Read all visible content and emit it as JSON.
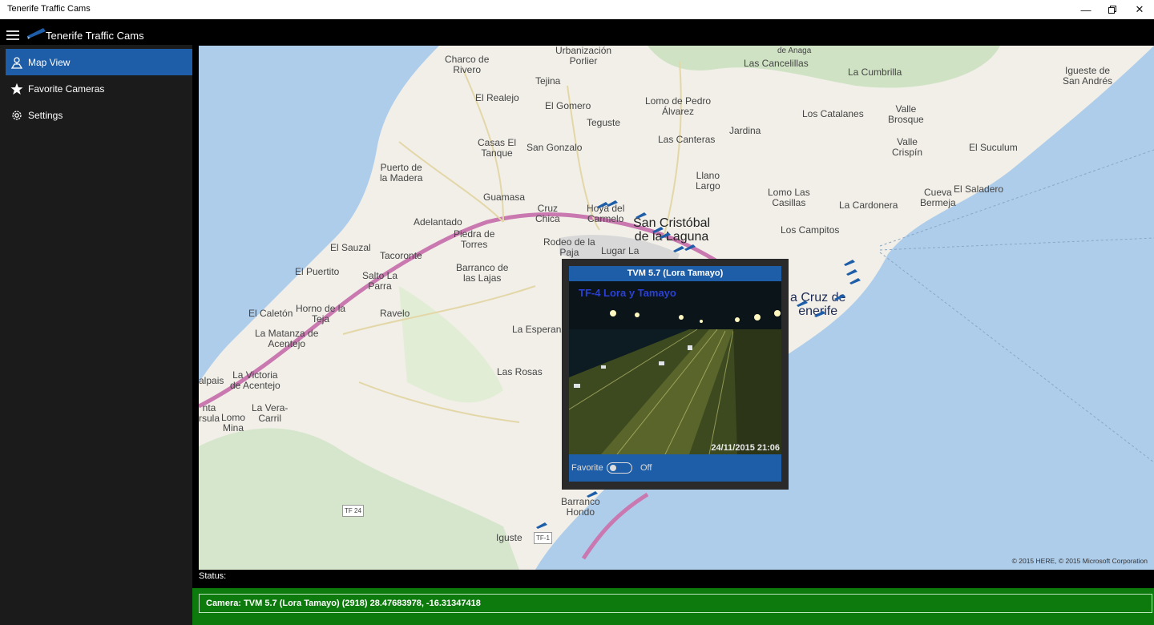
{
  "window": {
    "title": "Tenerife Traffic Cams",
    "minimize_icon": "minimize-icon",
    "restore_icon": "restore-icon",
    "close_icon": "close-icon"
  },
  "app": {
    "title": "Tenerife Traffic Cams",
    "menu_icon": "hamburger-icon",
    "logo_icon": "camera-logo-icon"
  },
  "nav": {
    "items": [
      {
        "label": "Map View",
        "icon": "map-pin-icon",
        "active": true
      },
      {
        "label": "Favorite Cameras",
        "icon": "star-icon",
        "active": false
      },
      {
        "label": "Settings",
        "icon": "gear-icon",
        "active": false
      }
    ]
  },
  "map": {
    "labels": [
      "Charco de\nRivero",
      "Urbanización\nPorlier",
      "Tejina",
      "El Realejo",
      "El Gomero",
      "Lomo de Pedro\nÁlvarez",
      "Teguste",
      "Casas El\nTanque",
      "San Gonzalo",
      "Las Canteras",
      "Jardina",
      "Puerto de\nla Madera",
      "Llano\nLargo",
      "Guamasa",
      "Cruz\nChica",
      "Hoya del\nCarmelo",
      "San Cristóbal\nde la Laguna",
      "Adelantado",
      "Piedra de\nTorres",
      "Rodeo de la\nPaja",
      "Lugar La",
      "El Sauzal",
      "Tacoronte",
      "El Puertito",
      "Salto La\nParra",
      "Barranco de\nlas Lajas",
      "El Caletón",
      "Horno de la\nTeja",
      "Ravelo",
      "La Matanza de\nAcentejo",
      "La Esperanza",
      "La Victoria\nde Acentejo",
      "Las Rosas",
      "alpais",
      "La Vera-\nCarril",
      "Lomo\nMina",
      "nta\nrsula",
      "Barranco\nHondo",
      "Iguste",
      "de Anaga",
      "Las Cancelillas",
      "La Cumbrilla",
      "Igueste de\nSan Andrés",
      "Los Catalanes",
      "Valle\nBrosque",
      "Valle\nCrispín",
      "El Suculum",
      "Lomo Las\nCasillas",
      "La Cardonera",
      "Cueva\nBermeja",
      "El Saladero",
      "Los Campitos",
      "a Cruz de\nenerife",
      "TF 24",
      "TF-1"
    ],
    "copyright": "© 2015 HERE, © 2015 Microsoft Corporation"
  },
  "popup": {
    "title": "TVM 5.7 (Lora Tamayo)",
    "overlay": "TF-4 Lora y Tamayo",
    "timestamp": "24/11/2015 21:06",
    "favorite_label": "Favorite",
    "favorite_state": "Off"
  },
  "status": {
    "label": "Status:",
    "text": "Camera: TVM 5.7 (Lora Tamayo) (2918) 28.47683978, -16.31347418"
  },
  "colors": {
    "accent": "#1e5ea8",
    "status_green": "#0d7a0d",
    "sea": "#aecdeb",
    "land": "#f1efe8",
    "forest": "#cfe3c4",
    "motorway": "#c978b0"
  }
}
